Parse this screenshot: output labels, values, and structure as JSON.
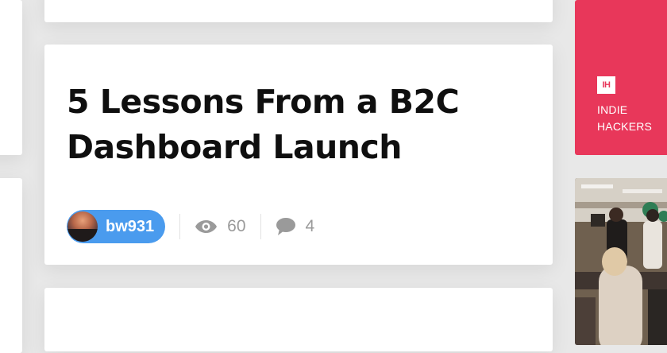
{
  "post": {
    "title_line1": "5 Lessons From a B2C",
    "title_line2": "Dashboard Launch",
    "author": "bw931",
    "views": "60",
    "comments": "4"
  },
  "icons": {
    "views": "eye-icon",
    "comments": "comment-icon",
    "sponsor_logo": "IH"
  },
  "sponsor": {
    "logo_text": "IH",
    "name_line1": "INDIE",
    "name_line2": "HACKERS"
  },
  "colors": {
    "page_background": "#e8e8e8",
    "card_background": "#ffffff",
    "author_pill": "#4a9bee",
    "sponsor_background": "#e8375a",
    "meta_text": "#9a9a9a",
    "title_text": "#0f0f0f"
  }
}
